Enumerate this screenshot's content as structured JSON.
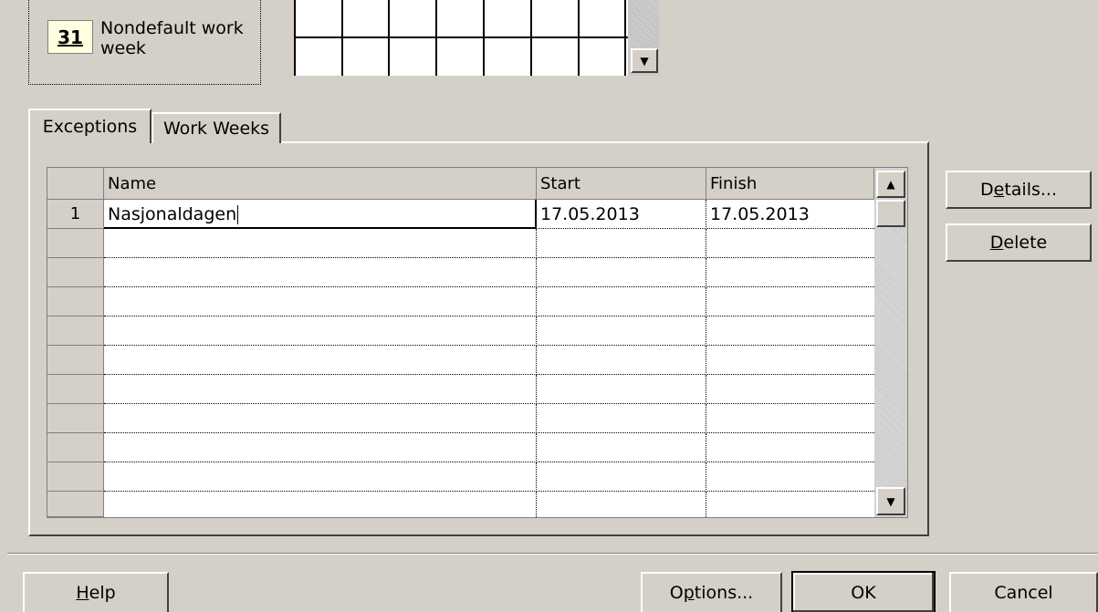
{
  "legend": {
    "swatch_number": "31",
    "label": "Nondefault work week"
  },
  "tabs": [
    {
      "label": "Exceptions",
      "active": true
    },
    {
      "label": "Work Weeks",
      "active": false
    }
  ],
  "grid": {
    "columns": [
      "Name",
      "Start",
      "Finish"
    ],
    "rows": [
      {
        "num": "1",
        "name": "Nasjonaldagen",
        "start": "17.05.2013",
        "finish": "17.05.2013"
      }
    ]
  },
  "side_buttons": {
    "details": {
      "pre": "D",
      "accel": "e",
      "post": "tails..."
    },
    "delete": {
      "pre": "",
      "accel": "D",
      "post": "elete"
    }
  },
  "footer": {
    "help": {
      "pre": "",
      "accel": "H",
      "post": "elp"
    },
    "options": {
      "pre": "O",
      "accel": "p",
      "post": "tions..."
    },
    "ok": "OK",
    "cancel": "Cancel"
  },
  "icons": {
    "scroll_up": "▲",
    "scroll_down": "▼"
  }
}
